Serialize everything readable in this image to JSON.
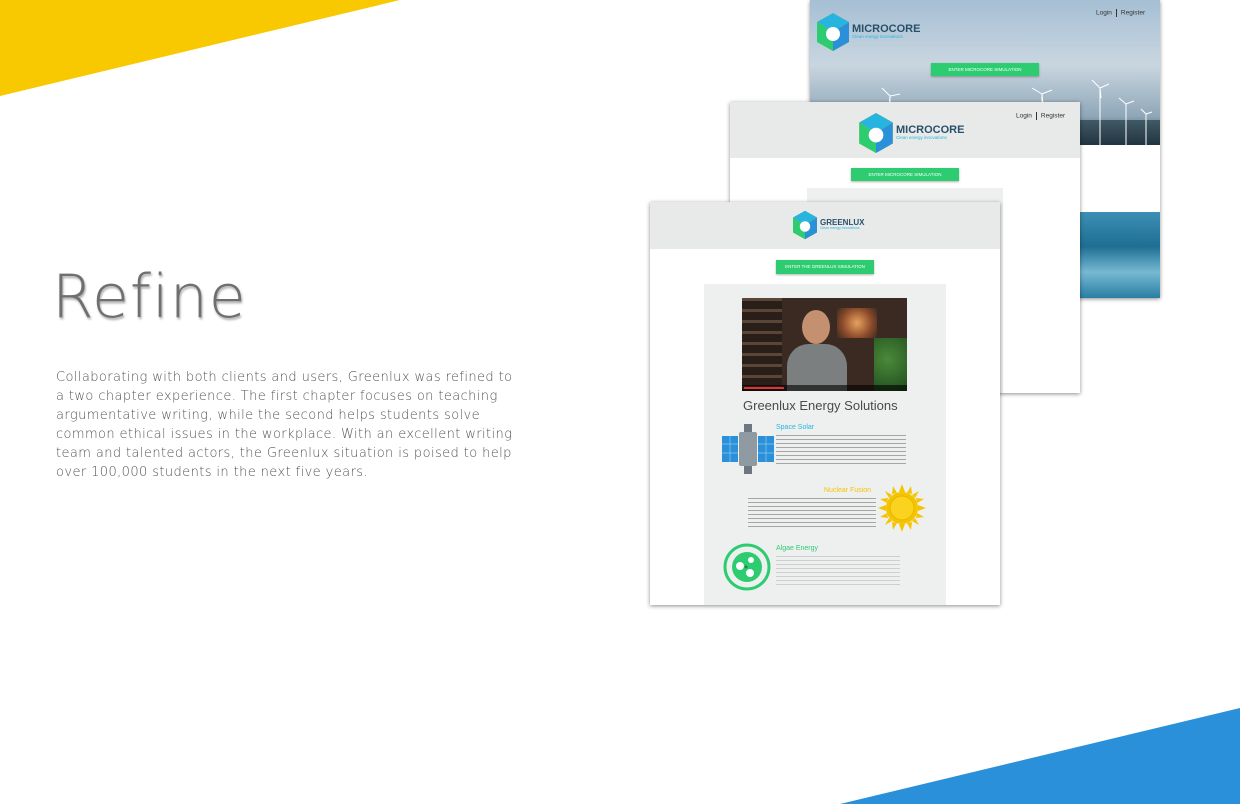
{
  "heading": "Refine",
  "description": "Collaborating with both clients and users, Greenlux was refined to a two chapter experience.  The first chapter focuses on teaching argumentative writing, while the second helps students solve common ethical issues in the workplace.  With an excellent writing team and talented actors, the Greenlux situation is poised to help over 100,000 students in the next five years.",
  "colors": {
    "yellow_accent": "#f8c900",
    "blue_accent": "#2a90d9",
    "cta_green": "#2ecc71"
  },
  "mockup_back": {
    "nav": {
      "login": "Login",
      "register": "Register"
    },
    "logo": {
      "name": "MICROCORE",
      "tagline": "Clean energy innovations"
    },
    "cta": "ENTER MICROCORE SIMULATION"
  },
  "mockup_middle": {
    "nav": {
      "login": "Login",
      "register": "Register"
    },
    "logo": {
      "name": "MICROCORE",
      "tagline": "Clean energy innovations"
    },
    "cta": "ENTER MICROCORE SIMULATION"
  },
  "mockup_front": {
    "logo": {
      "name": "GREENLUX",
      "tagline": "Clean energy innovations"
    },
    "cta": "ENTER THE GREENLUX SIMULATION",
    "section_title": "Greenlux Energy Solutions",
    "features": [
      {
        "title": "Space Solar",
        "icon": "satellite-icon",
        "color": "#27b5e0"
      },
      {
        "title": "Nuclear Fusion",
        "icon": "sun-icon",
        "color": "#f5c400"
      },
      {
        "title": "Algae Energy",
        "icon": "algae-cell-icon",
        "color": "#2ecc71"
      }
    ]
  }
}
